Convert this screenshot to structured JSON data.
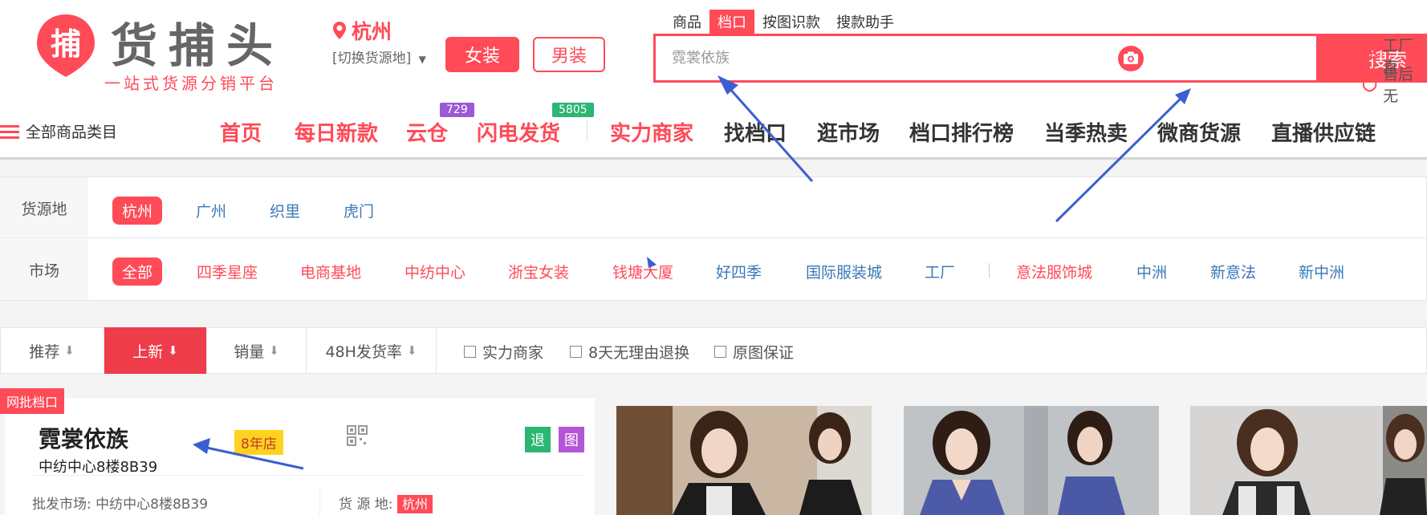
{
  "header": {
    "logo_glyph": "捕",
    "logo_title": "货捕头",
    "logo_slogan": "一站式货源分销平台",
    "location": {
      "city": "杭州",
      "switch_label": "[切换货源地]"
    },
    "category_buttons": {
      "women": "女装",
      "men": "男装"
    },
    "search": {
      "tabs": [
        {
          "label": "商品",
          "active": false
        },
        {
          "label": "档口",
          "active": true
        },
        {
          "label": "按图识款",
          "active": false
        },
        {
          "label": "搜款助手",
          "active": false
        }
      ],
      "placeholder": "霓裳依族",
      "button_label": "搜索"
    },
    "side_links": [
      "工厂直",
      "售后无"
    ]
  },
  "nav": {
    "all_categories": "全部商品类目",
    "items": [
      {
        "label": "首页",
        "red": true
      },
      {
        "label": "每日新款",
        "red": true
      },
      {
        "label": "云仓",
        "red": true,
        "badge": "729",
        "badge_color": "#9b59d6"
      },
      {
        "label": "闪电发货",
        "red": true,
        "badge": "5805",
        "badge_color": "#2bb673"
      },
      {
        "label": "实力商家",
        "red": true
      },
      {
        "label": "找档口",
        "red": false
      },
      {
        "label": "逛市场",
        "red": false
      },
      {
        "label": "档口排行榜",
        "red": false
      },
      {
        "label": "当季热卖",
        "red": false
      },
      {
        "label": "微商货源",
        "red": false
      },
      {
        "label": "直播供应链",
        "red": false
      }
    ]
  },
  "filters": {
    "source": {
      "label": "货源地",
      "options": [
        {
          "label": "杭州",
          "active": true
        },
        {
          "label": "广州",
          "active": false
        },
        {
          "label": "织里",
          "active": false
        },
        {
          "label": "虎门",
          "active": false
        }
      ]
    },
    "market": {
      "label": "市场",
      "options": [
        {
          "label": "全部",
          "style": "active"
        },
        {
          "label": "四季星座",
          "style": "red"
        },
        {
          "label": "电商基地",
          "style": "red"
        },
        {
          "label": "中纺中心",
          "style": "red"
        },
        {
          "label": "浙宝女装",
          "style": "red"
        },
        {
          "label": "钱塘大厦",
          "style": "red"
        },
        {
          "label": "好四季",
          "style": "blue"
        },
        {
          "label": "国际服装城",
          "style": "blue"
        },
        {
          "label": "工厂",
          "style": "blue"
        },
        {
          "label": "意法服饰城",
          "style": "red"
        },
        {
          "label": "中洲",
          "style": "blue"
        },
        {
          "label": "新意法",
          "style": "blue"
        },
        {
          "label": "新中洲",
          "style": "blue"
        }
      ]
    }
  },
  "sort": {
    "options": [
      {
        "label": "推荐",
        "active": false
      },
      {
        "label": "上新",
        "active": true
      },
      {
        "label": "销量",
        "active": false
      },
      {
        "label": "48H发货率",
        "active": false
      }
    ],
    "arrow": "⬇",
    "checkboxes": [
      "实力商家",
      "8天无理由退换",
      "原图保证"
    ]
  },
  "shop": {
    "tag": "网批档口",
    "name": "霓裳依族",
    "years": "8年店",
    "address": "中纺中心8楼8B39",
    "wholesale_label": "批发市场:",
    "wholesale_value": "中纺中心8楼8B39",
    "source_label": "货 源 地:",
    "source_value": "杭州",
    "icon_tags": [
      {
        "label": "退",
        "color": "#2bb673"
      },
      {
        "label": "图",
        "color": "#b455d8"
      }
    ]
  },
  "colors": {
    "brand": "#ff4a57",
    "link_blue": "#3a78b8",
    "arrow": "#3b5fd1"
  }
}
